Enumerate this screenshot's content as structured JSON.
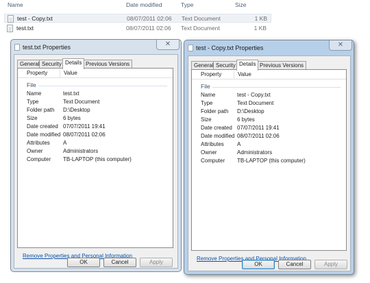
{
  "explorer": {
    "columns": {
      "name": "Name",
      "date": "Date modified",
      "type": "Type",
      "size": "Size"
    },
    "files": [
      {
        "name": "test - Copy.txt",
        "date": "08/07/2011 02:06",
        "type": "Text Document",
        "size": "1 KB"
      },
      {
        "name": "test.txt",
        "date": "08/07/2011 02:06",
        "type": "Text Document",
        "size": "1 KB"
      }
    ]
  },
  "dialogs": [
    {
      "title": "test.txt Properties",
      "tabs": [
        "General",
        "Security",
        "Details",
        "Previous Versions"
      ],
      "header": {
        "property": "Property",
        "value": "Value"
      },
      "group": "File",
      "rows": [
        {
          "name": "Name",
          "value": "test.txt"
        },
        {
          "name": "Type",
          "value": "Text Document"
        },
        {
          "name": "Folder path",
          "value": "D:\\Desktop"
        },
        {
          "name": "Size",
          "value": "6 bytes"
        },
        {
          "name": "Date created",
          "value": "07/07/2011 19:41"
        },
        {
          "name": "Date modified",
          "value": "08/07/2011 02:06"
        },
        {
          "name": "Attributes",
          "value": "A"
        },
        {
          "name": "Owner",
          "value": "Administrators"
        },
        {
          "name": "Computer",
          "value": "TB-LAPTOP (this computer)"
        }
      ],
      "link": "Remove Properties and Personal Information",
      "buttons": {
        "ok": "OK",
        "cancel": "Cancel",
        "apply": "Apply"
      }
    },
    {
      "title": "test - Copy.txt Properties",
      "tabs": [
        "General",
        "Security",
        "Details",
        "Previous Versions"
      ],
      "header": {
        "property": "Property",
        "value": "Value"
      },
      "group": "File",
      "rows": [
        {
          "name": "Name",
          "value": "test - Copy.txt"
        },
        {
          "name": "Type",
          "value": "Text Document"
        },
        {
          "name": "Folder path",
          "value": "D:\\Desktop"
        },
        {
          "name": "Size",
          "value": "6 bytes"
        },
        {
          "name": "Date created",
          "value": "07/07/2011 19:41"
        },
        {
          "name": "Date modified",
          "value": "08/07/2011 02:06"
        },
        {
          "name": "Attributes",
          "value": "A"
        },
        {
          "name": "Owner",
          "value": "Administrators"
        },
        {
          "name": "Computer",
          "value": "TB-LAPTOP (this computer)"
        }
      ],
      "link": "Remove Properties and Personal Information",
      "buttons": {
        "ok": "OK",
        "cancel": "Cancel",
        "apply": "Apply"
      }
    }
  ]
}
